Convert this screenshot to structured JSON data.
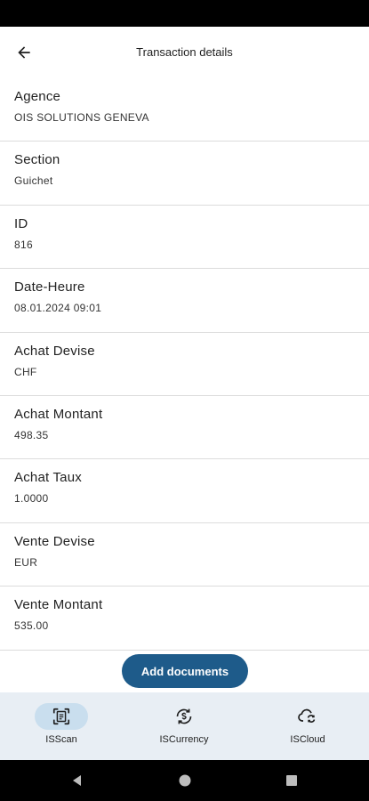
{
  "header": {
    "title": "Transaction details",
    "back_icon": "arrow-left-icon"
  },
  "fields": [
    {
      "label": "Agence",
      "value": "OIS SOLUTIONS GENEVA"
    },
    {
      "label": "Section",
      "value": "Guichet"
    },
    {
      "label": "ID",
      "value": "816"
    },
    {
      "label": "Date-Heure",
      "value": "08.01.2024 09:01"
    },
    {
      "label": "Achat Devise",
      "value": "CHF"
    },
    {
      "label": "Achat Montant",
      "value": "498.35"
    },
    {
      "label": "Achat Taux",
      "value": "1.0000"
    },
    {
      "label": "Vente Devise",
      "value": "EUR"
    },
    {
      "label": "Vente Montant",
      "value": "535.00"
    }
  ],
  "actions": {
    "add_documents_label": "Add documents"
  },
  "bottom_nav": {
    "items": [
      {
        "label": "ISScan",
        "icon": "document-scan-icon",
        "active": true
      },
      {
        "label": "ISCurrency",
        "icon": "currency-exchange-icon",
        "active": false
      },
      {
        "label": "ISCloud",
        "icon": "cloud-sync-icon",
        "active": false
      }
    ]
  },
  "colors": {
    "primary": "#1e5b8a",
    "nav_background": "#e8eef4",
    "nav_active_pill": "#c9deee",
    "divider": "#dcdcdc"
  }
}
